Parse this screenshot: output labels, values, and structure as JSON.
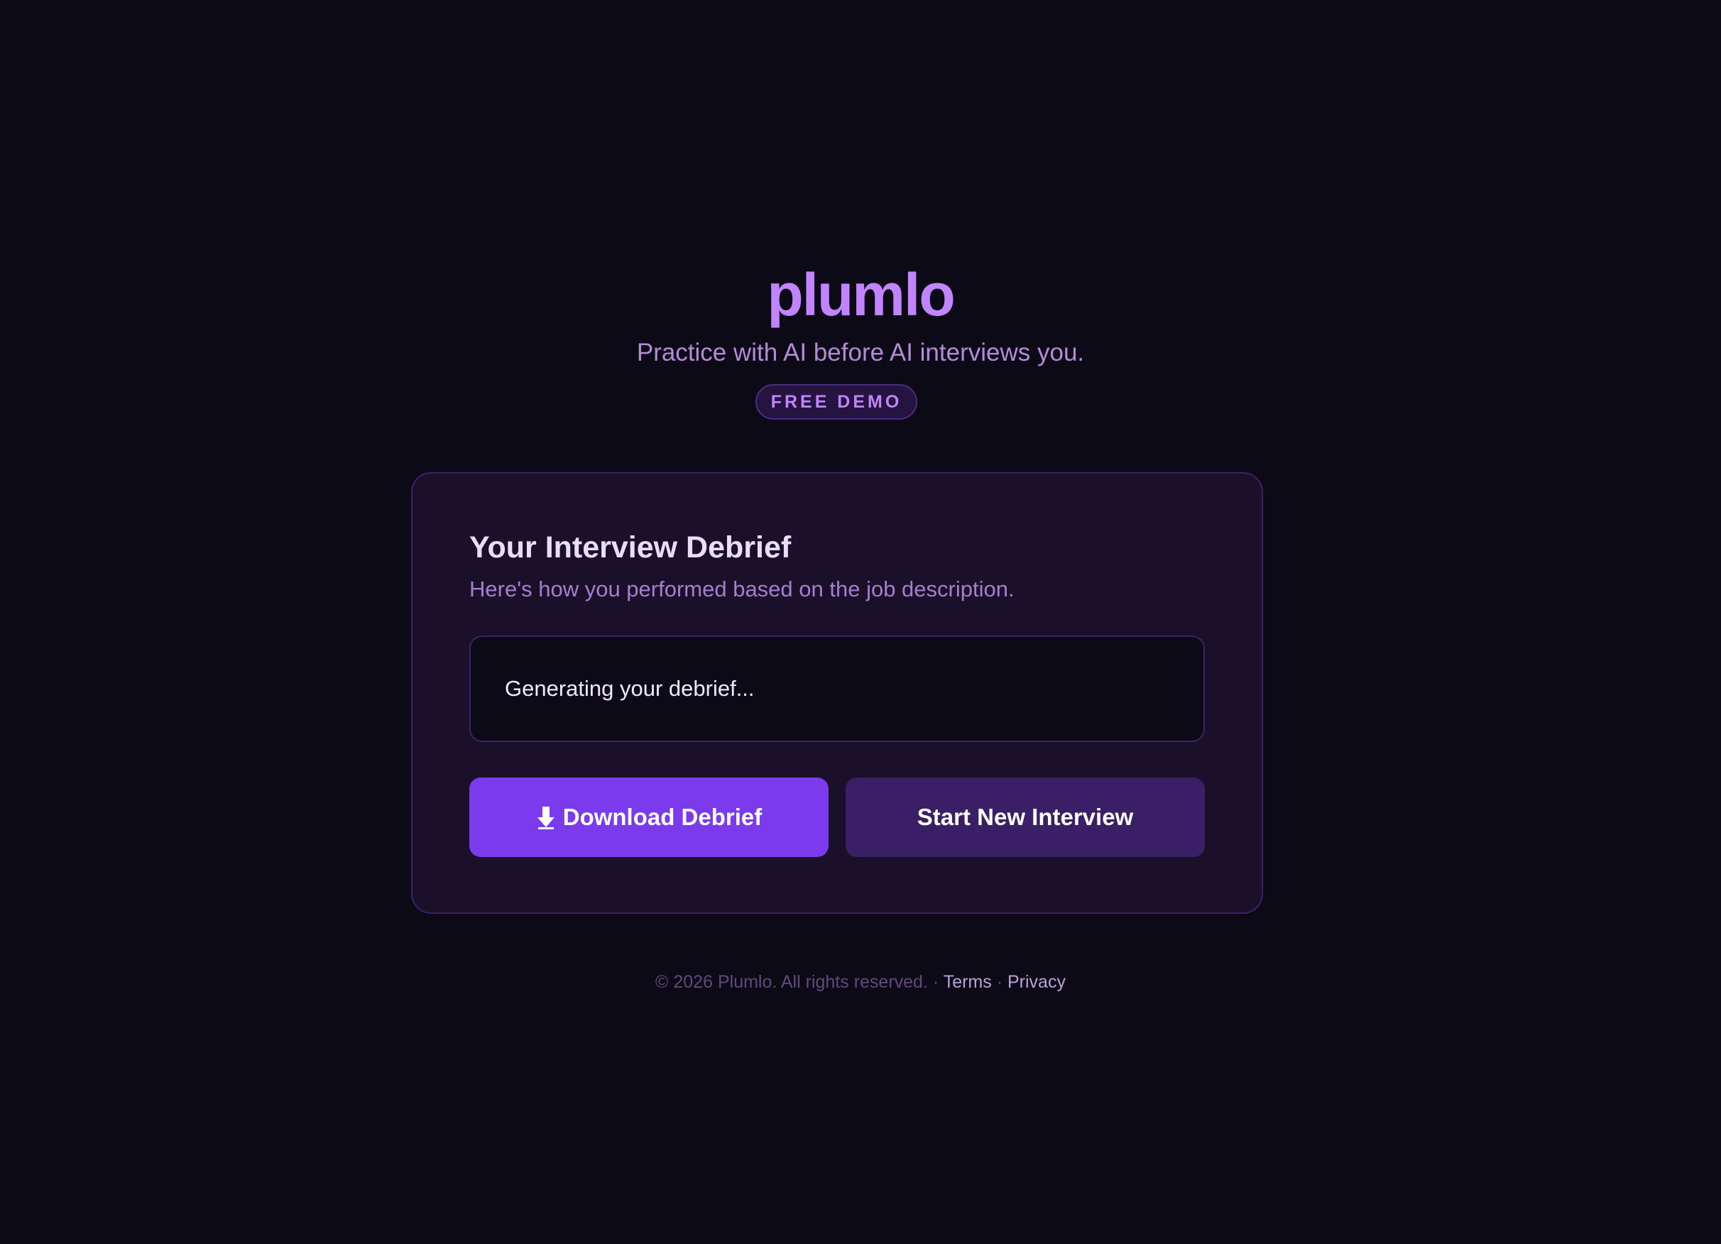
{
  "brand": {
    "name": "plumlo",
    "tagline": "Practice with AI before AI interviews you.",
    "badge": "FREE DEMO"
  },
  "card": {
    "title": "Your Interview Debrief",
    "subtitle": "Here's how you performed based on the job description.",
    "status": "Generating your debrief...",
    "buttons": {
      "download": "Download Debrief",
      "download_icon": "download-arrow-icon",
      "new_interview": "Start New Interview"
    }
  },
  "footer": {
    "copyright": "© 2026 Plumlo. All rights reserved.",
    "separator": "·",
    "terms": "Terms",
    "privacy": "Privacy"
  },
  "colors": {
    "background": "#0d0a18",
    "brand": "#c084fc",
    "accent": "#7c3aed",
    "secondary_button": "#3b1f66",
    "card": "#1b1029"
  }
}
